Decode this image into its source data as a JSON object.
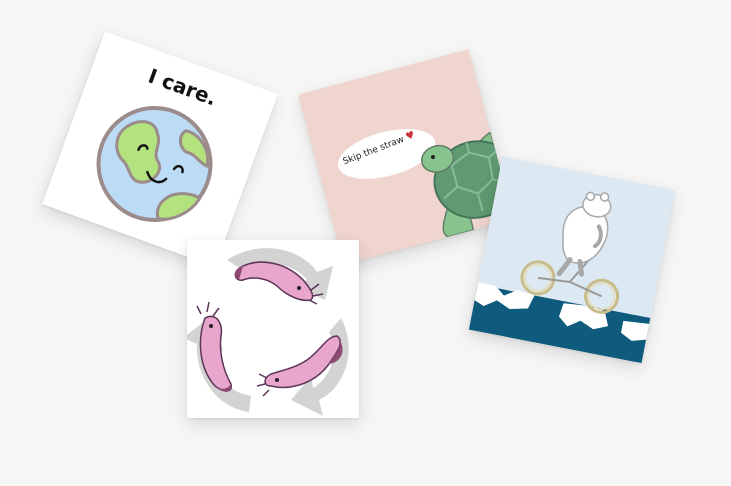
{
  "stickers": {
    "earth": {
      "caption": "I care.",
      "icon": "smiling-earth-icon"
    },
    "turtle": {
      "bubble_text": "Skip the straw",
      "heart": "♥",
      "icon": "sea-turtle-icon"
    },
    "bear": {
      "icon": "polar-bear-bicycle-icon"
    },
    "axolotl": {
      "icon": "axolotl-recycle-icon"
    }
  },
  "colors": {
    "background": "#f6f6f6",
    "earth_ocean": "#bcdcf5",
    "earth_land": "#b3e27f",
    "turtle_bg": "#f0d5ce",
    "turtle_shell": "#5f9a72",
    "heart": "#c7313a",
    "bear_bg": "#dce9f3",
    "water": "#0f5b7d",
    "axolotl_pink": "#e8a6cc",
    "axolotl_tail": "#8c4a73",
    "arrow_grey": "#d3d3d3"
  }
}
